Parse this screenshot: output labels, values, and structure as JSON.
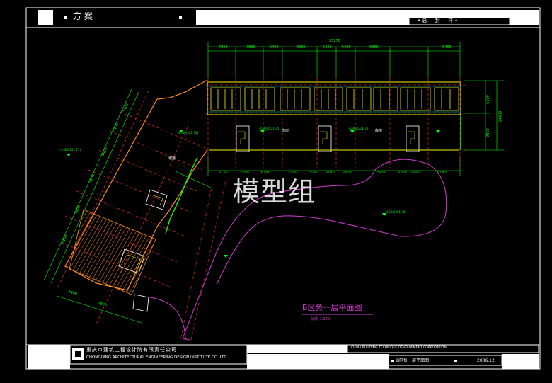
{
  "header": {
    "scheme_label": "方 案",
    "right_label": "• 总 　 封 　 样 •"
  },
  "watermark": "模型组",
  "dimensions": {
    "top_overall": "55270",
    "top_segments": [
      "7800",
      "7800",
      "5400",
      "9900",
      "5400",
      "5400",
      "9900",
      "5400"
    ],
    "bottom_segments": [
      "6150",
      "2700",
      "6150",
      "2700",
      "2700",
      "6150",
      "2700",
      "5400",
      "2700",
      "2700",
      "6150"
    ],
    "right_segments": [
      "6600",
      "7800"
    ],
    "right_overall": "14400",
    "left_wing_segments": [
      "5400",
      "5400",
      "5400",
      "7800",
      "7800",
      "5400"
    ],
    "lower_left": [
      "6400",
      "7800"
    ]
  },
  "elevations": {
    "e1": "-4.900(221.75)",
    "e2": "-4.900(221.75)",
    "e3": "-4.900(221.75)",
    "e4": "-4.900(221.75)",
    "e5": "-4.950(221.70)"
  },
  "room_labels": {
    "ramp": "坡道",
    "r1": "库房",
    "r2": "库房"
  },
  "plan": {
    "title": "B区负一层平面图",
    "scale": "比例 1:100"
  },
  "title_block": {
    "company_cn": "重庆市建筑工程设计院有限责任公司",
    "company_en": "CHONGQING ARCHITECTURAL ENGINEERING DESIGN INSTITUTE CO.,LTD",
    "corp_en": "CHINA BUILDING TECHNIQUE DEVELOPMENT CORPORATION",
    "drawing_name": "B区负一层平面图",
    "date": "2006.12"
  },
  "colors": {
    "frame": "#ffffff",
    "magenta": "#d63ad6",
    "yellow": "#f2f200",
    "green": "#00ff00",
    "cyan": "#00d8d8",
    "orange": "#ff8c1a",
    "red": "#ff3030"
  }
}
